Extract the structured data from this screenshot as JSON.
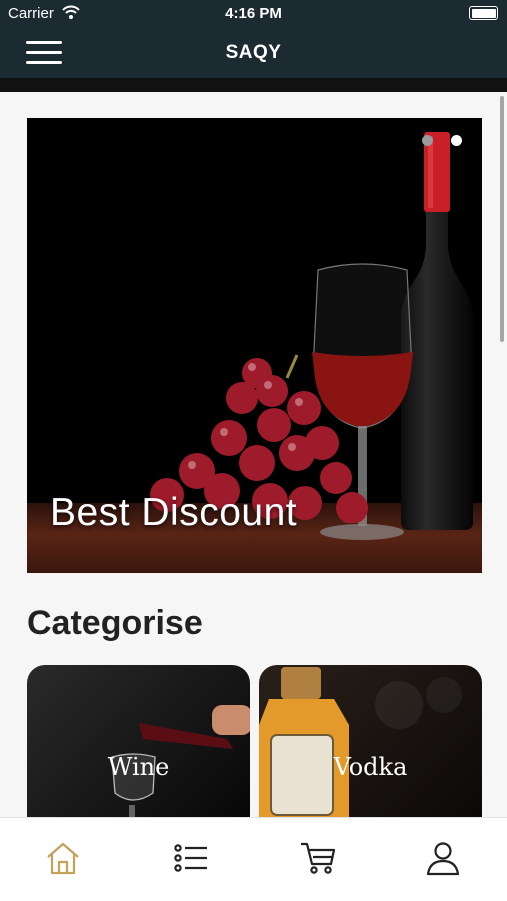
{
  "status_bar": {
    "carrier": "Carrier",
    "time": "4:16 PM"
  },
  "app_bar": {
    "title": "SAQY"
  },
  "banner": {
    "title": "Best Discount",
    "slide_count": 2,
    "active_slide": 2
  },
  "categories": {
    "heading": "Categorise",
    "items": [
      {
        "label": "Wine"
      },
      {
        "label": "Vodka"
      }
    ]
  },
  "tab_bar": {
    "active_tab": "home",
    "active_color": "#c5a25a",
    "inactive_color": "#222222",
    "tabs": [
      {
        "icon": "home-icon"
      },
      {
        "icon": "list-icon"
      },
      {
        "icon": "cart-icon"
      },
      {
        "icon": "profile-icon"
      }
    ]
  },
  "colors": {
    "header": "#1c2a32",
    "background": "#f6f6f6"
  }
}
